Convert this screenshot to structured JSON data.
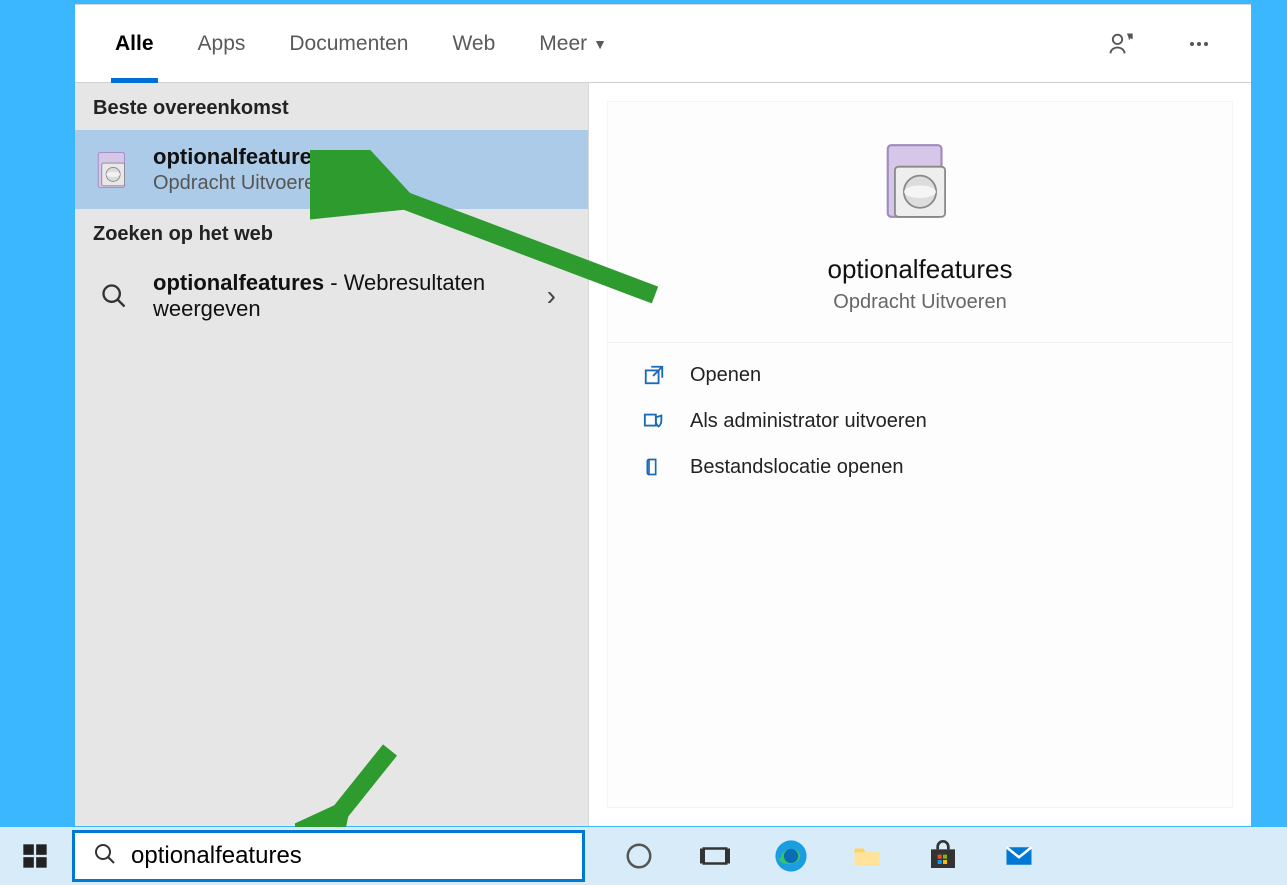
{
  "tabs": {
    "all": "Alle",
    "apps": "Apps",
    "documents": "Documenten",
    "web": "Web",
    "more": "Meer"
  },
  "left": {
    "best_match_header": "Beste overeenkomst",
    "best_match": {
      "title": "optionalfeatures",
      "subtitle": "Opdracht Uitvoeren"
    },
    "web_header": "Zoeken op het web",
    "web_result": {
      "bold": "optionalfeatures",
      "rest": " - Webresultaten weergeven"
    }
  },
  "preview": {
    "title": "optionalfeatures",
    "subtitle": "Opdracht Uitvoeren",
    "actions": {
      "open": "Openen",
      "run_admin": "Als administrator uitvoeren",
      "open_location": "Bestandslocatie openen"
    }
  },
  "search": {
    "value": "optionalfeatures"
  }
}
